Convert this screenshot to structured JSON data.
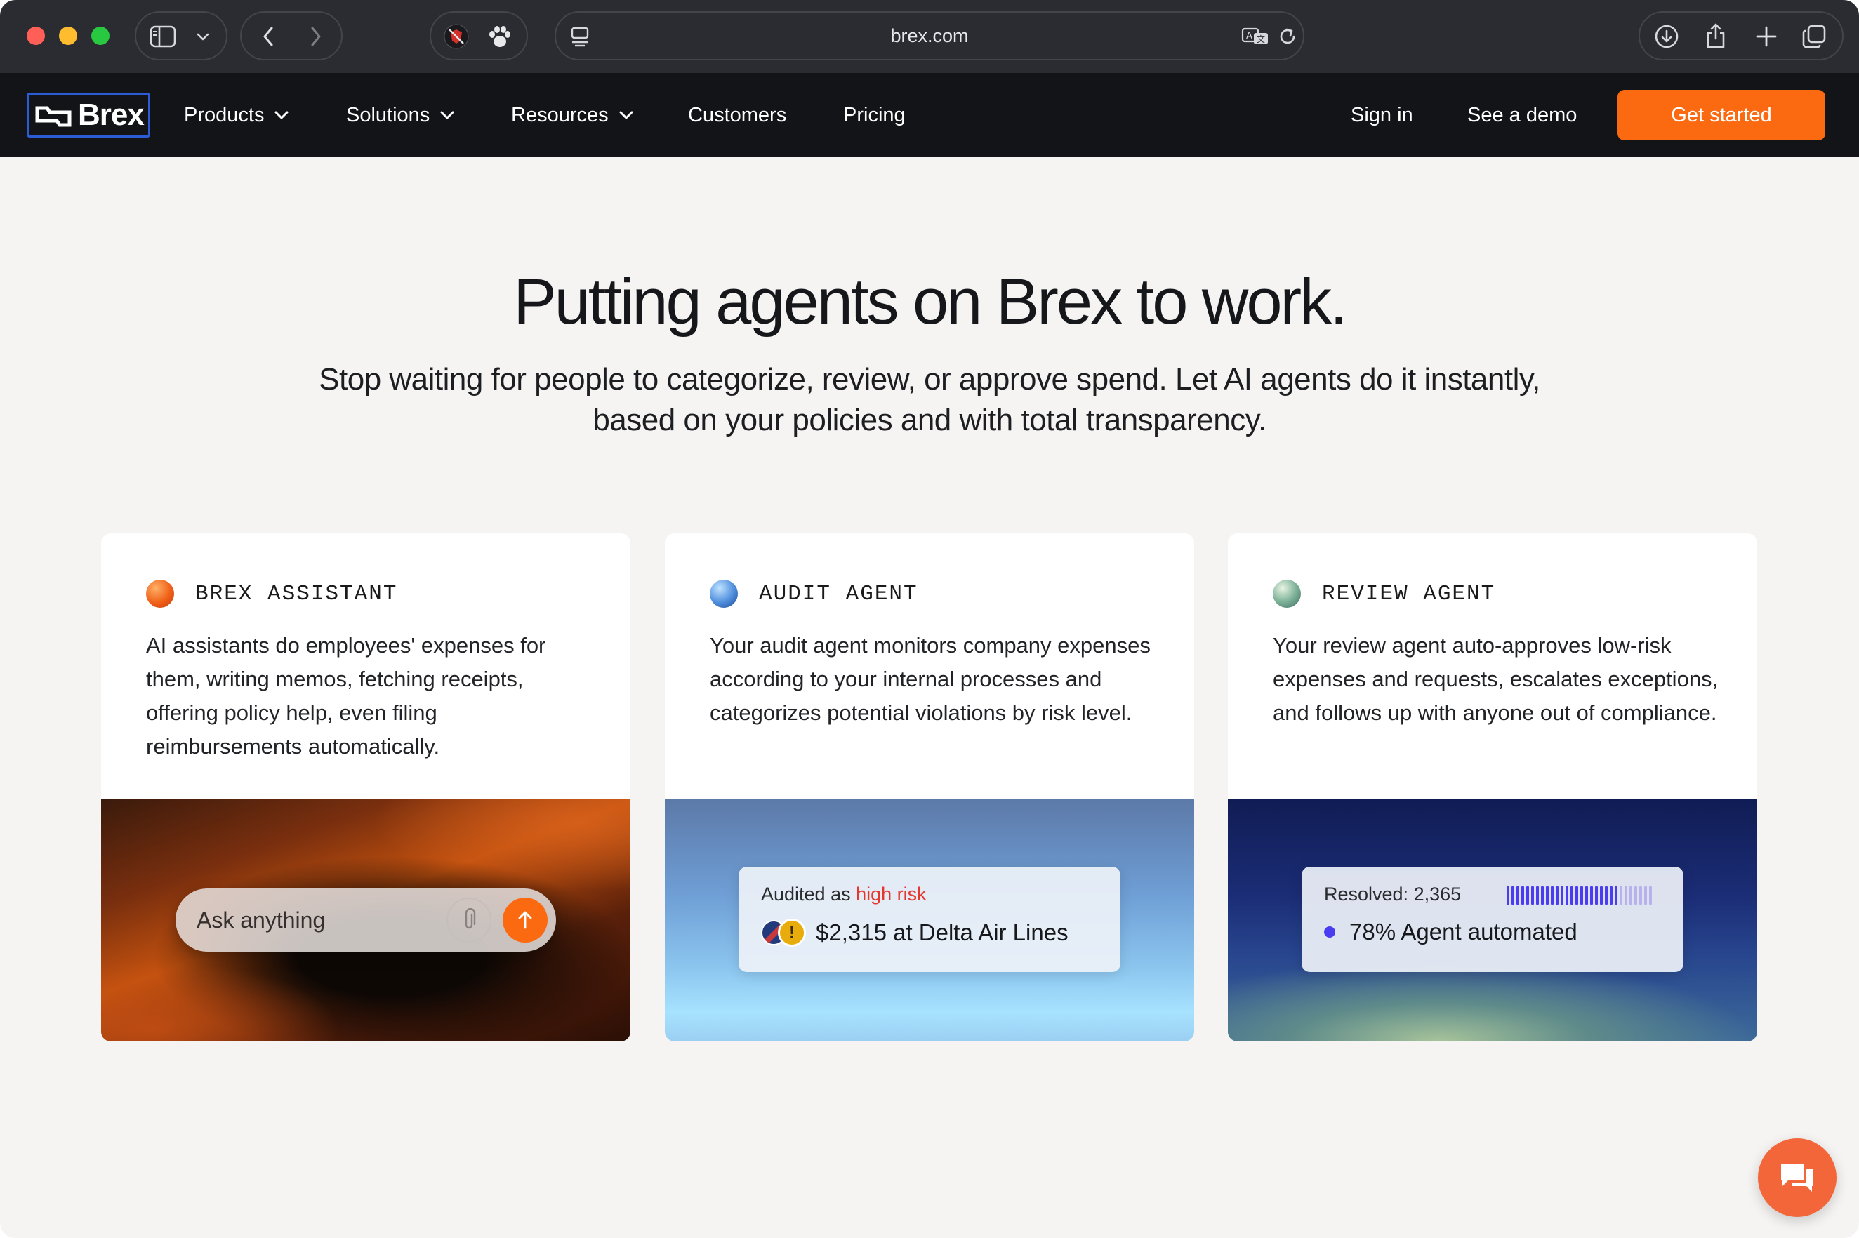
{
  "browser": {
    "url": "brex.com"
  },
  "nav": {
    "logo": "Brex",
    "items": [
      {
        "label": "Products"
      },
      {
        "label": "Solutions"
      },
      {
        "label": "Resources"
      },
      {
        "label": "Customers"
      },
      {
        "label": "Pricing"
      }
    ],
    "sign_in": "Sign in",
    "demo": "See a demo",
    "get_started": "Get started"
  },
  "hero": {
    "title": "Putting agents on Brex to work.",
    "subtitle_line1": "Stop waiting for people to categorize, review, or approve spend. Let AI agents do it instantly,",
    "subtitle_line2": "based on your policies and with total transparency."
  },
  "cards": [
    {
      "label": "BREX ASSISTANT",
      "description": "AI assistants do employees' expenses for them, writing memos, fetching receipts, offering policy help, even filing reimbursements automatically.",
      "input_placeholder": "Ask anything"
    },
    {
      "label": "AUDIT AGENT",
      "description": "Your audit agent monitors company expenses according to your internal processes and categorizes potential violations by risk level.",
      "audit_prefix": "Audited as",
      "audit_risk": "high risk",
      "warning_glyph": "!",
      "amount_line": "$2,315 at Delta Air Lines"
    },
    {
      "label": "REVIEW AGENT",
      "description": "Your review agent auto-approves low-risk expenses and requests, escalates exceptions, and follows up with anyone out of compliance.",
      "resolved": "Resolved: 2,365",
      "automated_share": 0.78,
      "automated_line": "78% Agent automated"
    }
  ],
  "colors": {
    "accent_orange": "#fb6a10",
    "nav_bg": "#121418",
    "page_bg": "#f5f4f2",
    "risk_red": "#e5382d",
    "automated_blue": "#4a3cf0"
  },
  "icons": {
    "sidebar": "sidebar-icon",
    "back": "chevron-left-icon",
    "forward": "chevron-right-icon",
    "extension_1": "shield-extension-icon",
    "extension_2": "paw-icon",
    "tab_list": "tab-list-icon",
    "translate": "translate-icon",
    "reload": "reload-icon",
    "download": "download-icon",
    "share": "share-icon",
    "new_tab": "plus-icon",
    "tabs_overview": "tabs-overview-icon",
    "attach": "paperclip-icon",
    "send": "arrow-up-icon",
    "chat": "chat-bubbles-icon"
  }
}
